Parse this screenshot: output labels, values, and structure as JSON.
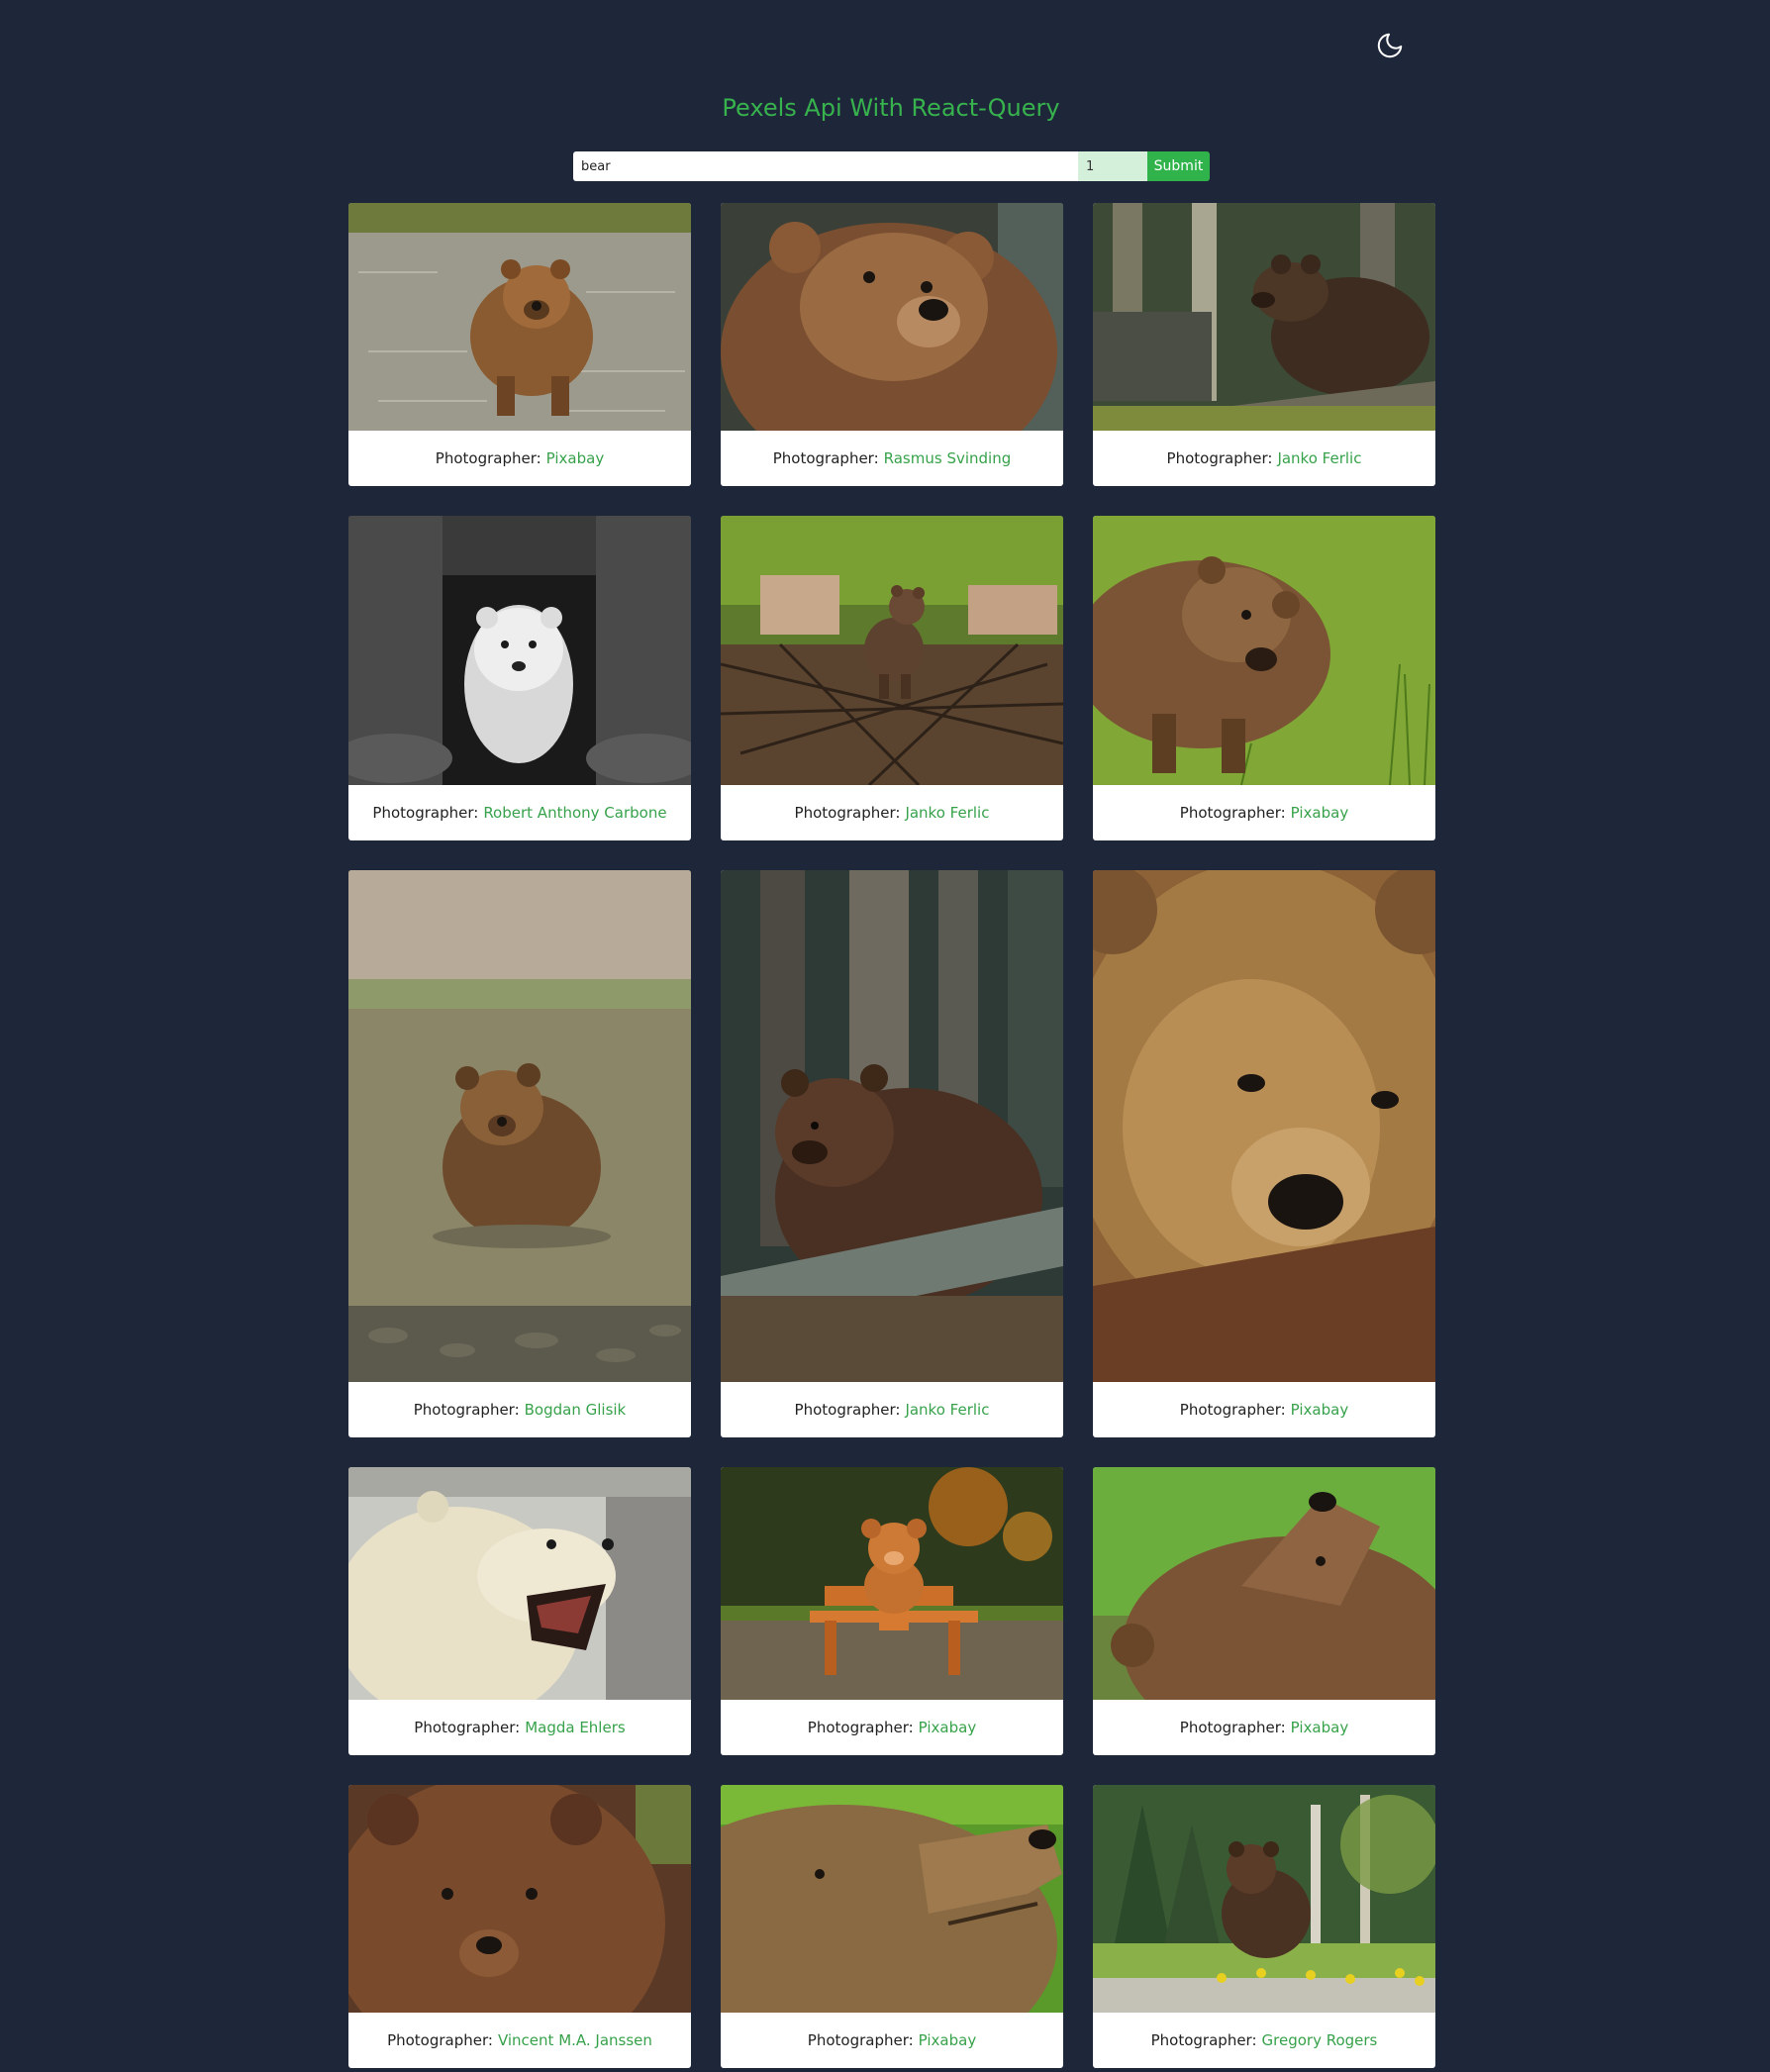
{
  "app": {
    "title": "Pexels Api With React-Query",
    "theme_toggle_icon": "moon-icon"
  },
  "search": {
    "query": "bear",
    "page": "1",
    "submit_label": "Submit"
  },
  "colors": {
    "background": "#1e273a",
    "accent": "#37b24d",
    "submit": "#2fb34a",
    "page_field": "#d5f0da"
  },
  "caption_label": "Photographer:",
  "photos": [
    {
      "photographer": "Pixabay",
      "subject": "brown bear standing in shallow river"
    },
    {
      "photographer": "Rasmus Svinding",
      "subject": "close-up of brown bear looking up"
    },
    {
      "photographer": "Janko Ferlic",
      "subject": "brown bear behind log in forest"
    },
    {
      "photographer": "Robert Anthony Carbone",
      "subject": "polar bear cub between mother's legs, black and white"
    },
    {
      "photographer": "Janko Ferlic",
      "subject": "bear cub on pile of branches"
    },
    {
      "photographer": "Pixabay",
      "subject": "brown bear walking on green grass"
    },
    {
      "photographer": "Bogdan Glisik",
      "subject": "brown bear sitting in pond"
    },
    {
      "photographer": "Janko Ferlic",
      "subject": "brown bear resting behind tree trunk"
    },
    {
      "photographer": "Pixabay",
      "subject": "close-up of brown bear face resting on log"
    },
    {
      "photographer": "Magda Ehlers",
      "subject": "polar bear yawning"
    },
    {
      "photographer": "Pixabay",
      "subject": "teddy bear sitting on wooden bench"
    },
    {
      "photographer": "Pixabay",
      "subject": "brown bear looking up in meadow"
    },
    {
      "photographer": "Vincent M.A. Janssen",
      "subject": "brown bear face portrait"
    },
    {
      "photographer": "Pixabay",
      "subject": "brown bear head profile"
    },
    {
      "photographer": "Gregory Rogers",
      "subject": "bear sitting in grass near forest"
    }
  ]
}
